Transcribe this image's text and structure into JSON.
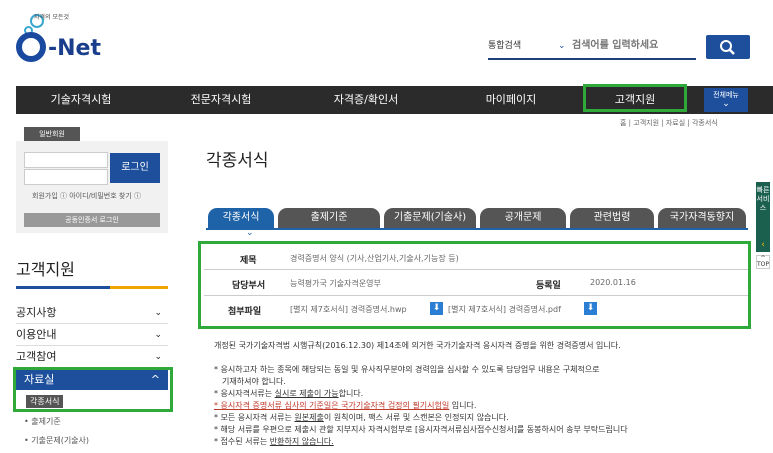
{
  "logo": {
    "tagline": "자격의 모든것",
    "name": "-Net"
  },
  "search": {
    "scope": "통합검색",
    "placeholder": "검색어를 입력하세요"
  },
  "nav": {
    "items": [
      "기술자격시험",
      "전문자격시험",
      "자격증/확인서",
      "마이페이지",
      "고객지원"
    ],
    "all_menu": "전체메뉴"
  },
  "breadcrumb": "홈 | 고객지원 | 자료실 | 각종서식",
  "login": {
    "tab": "일반회원",
    "button": "로그인",
    "links": "회원가입 ⓘ 아이디/비밀번호 찾기 ⓘ",
    "cert_button": "공동인증서 로그인"
  },
  "sidebar": {
    "title": "고객지원",
    "items": [
      "공지사항",
      "이용안내",
      "고객참여"
    ],
    "active": "자료실",
    "sub_items": [
      "각종서식",
      "출제기준",
      "기출문제(기술사)"
    ]
  },
  "page_title": "각종서식",
  "tabs": [
    "각종서식",
    "출제기준",
    "기출문제(기술사)",
    "공개문제",
    "관련법령",
    "국가자격동향지"
  ],
  "info": {
    "title_label": "제목",
    "title_value": "경력증명서 양식 (기사,산업기사,기술사,기능장 등)",
    "dept_label": "담당부서",
    "dept_value": "능력평가국 기술자격운영부",
    "date_label": "등록일",
    "date_value": "2020.01.16",
    "file_label": "첨부파일",
    "file1": "[별지 제7호서식] 경력증명서.hwp",
    "file2": "[별지 제7호서식] 경력증명서.pdf"
  },
  "body": {
    "intro": "개정된 국가기술자격법 시행규칙(2016.12.30) 제14조에 의거한 국가기술자격 응시자격 증명을 위한 경력증명서 입니다.",
    "b1a": "* 응시하고자 하는 종목에 해당되는 동일 및 유사직무분야의 경력임을 심사할 수 있도록 담당업무 내용은 구체적으로",
    "b1b": "기재하셔야 합니다.",
    "b2a": "* 응시자격서류는 ",
    "b2u": "실시로 제출이 가능",
    "b2b": "합니다.",
    "b3u": "* 응시자격 증명서류 심사의 기준일은 국가기술자격 검정의 필기시험일",
    "b3b": " 입니다.",
    "b4a": "* 모든 응시자격 서류는 ",
    "b4u": "원본제출",
    "b4b": "이 원칙이며, 팩스 서류 및 스캔본은 인정되지 않습니다.",
    "b5": "* 해당 서류를 우편으로 제출시 관할 지부지사 자격시험부로 [응시자격서류심사접수신청서]를 동봉하시어 송부 부탁드립니다",
    "b6a": "* 접수된 서류는 ",
    "b6u": "반환하지 않습니다."
  },
  "quick": {
    "label": "빠른서비스",
    "top": "TOP"
  }
}
